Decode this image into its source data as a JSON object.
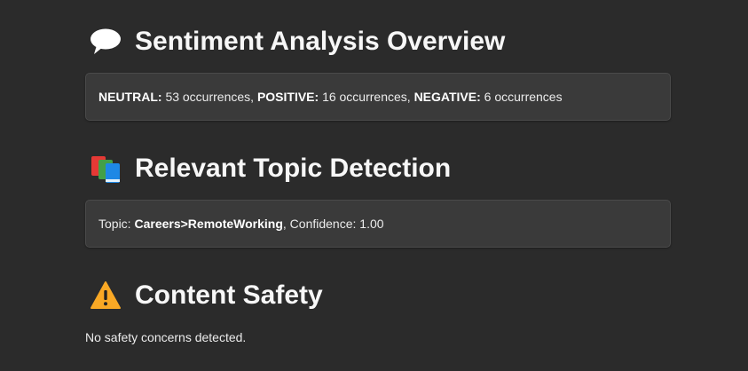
{
  "sentiment": {
    "title": "Sentiment Analysis Overview",
    "icon": "speech-bubble-icon",
    "items": [
      {
        "label": "NEUTRAL:",
        "value": "53 occurrences",
        "sep": ", "
      },
      {
        "label": "POSITIVE:",
        "value": "16 occurrences",
        "sep": ", "
      },
      {
        "label": "NEGATIVE:",
        "value": "6 occurrences",
        "sep": ""
      }
    ]
  },
  "topics": {
    "title": "Relevant Topic Detection",
    "icon": "books-icon",
    "prefix": "Topic: ",
    "topic": "Careers>RemoteWorking",
    "confidence_text": ", Confidence: 1.00"
  },
  "safety": {
    "title": "Content Safety",
    "icon": "warning-icon",
    "message": "No safety concerns detected."
  }
}
